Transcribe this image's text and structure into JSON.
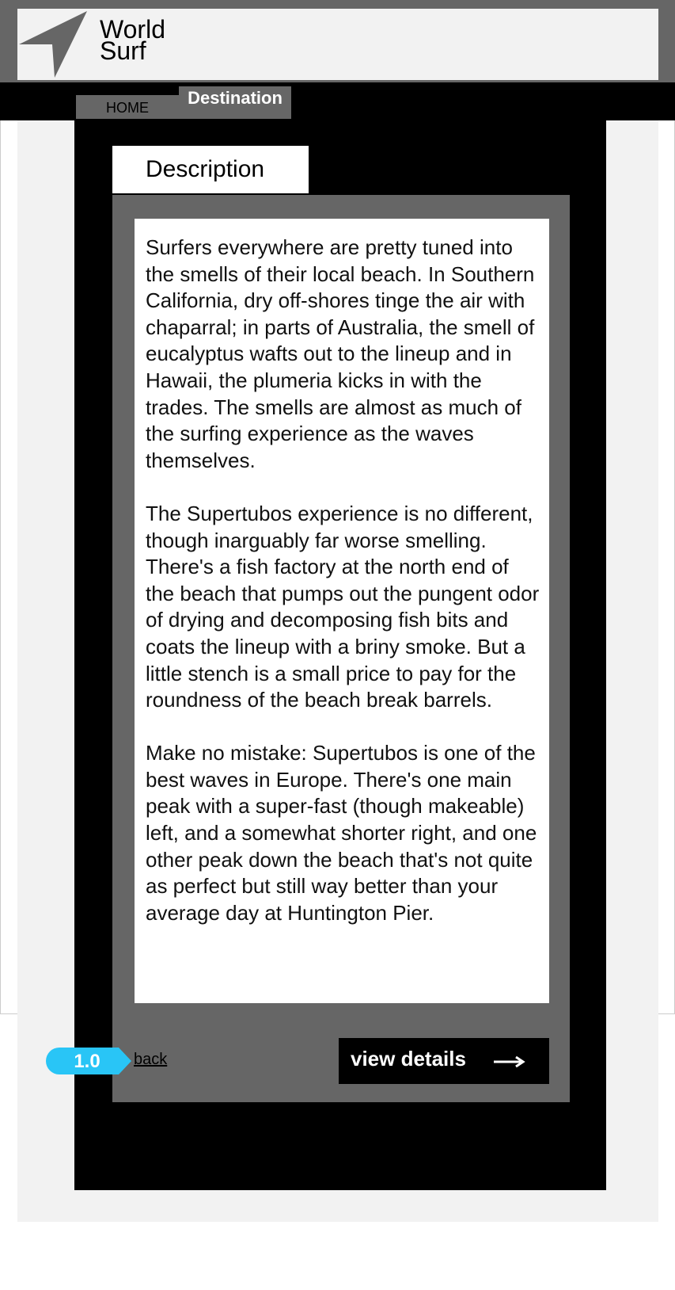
{
  "header": {
    "logo_line1": "World",
    "logo_line2": "Surf"
  },
  "nav": {
    "home": "HOME",
    "destination": "Destination"
  },
  "section": {
    "tab_label": "Description"
  },
  "description": {
    "p1": "Surfers everywhere are pretty tuned into the smells of their local beach. In Southern California, dry off-shores tinge the air with chaparral; in parts of Australia, the smell of eucalyptus wafts out to the lineup and in Hawaii, the plumeria kicks in with the trades. The smells are almost as much of the surfing experience as the waves themselves.",
    "p2": "The Supertubos experience is no different, though inarguably far worse smelling. There's a fish factory at the north end of the beach that pumps out the pungent odor of drying and decomposing fish bits and coats the lineup with a briny smoke. But a little stench is a small price to pay for the roundness of the beach break barrels.",
    "p3": "Make no mistake: Supertubos is one of the best waves in Europe. There's one main peak with a super-fast (though makeable) left, and a somewhat shorter right, and one other peak down the beach that's not quite as perfect but still way better than your average day at Huntington Pier."
  },
  "footer": {
    "version": "1.0",
    "back_label": "back",
    "view_details_label": "view details",
    "arrow_icon": "long-arrow-right-icon"
  },
  "colors": {
    "badge": "#29c5f6",
    "panel": "#666666",
    "dark": "#000000"
  }
}
